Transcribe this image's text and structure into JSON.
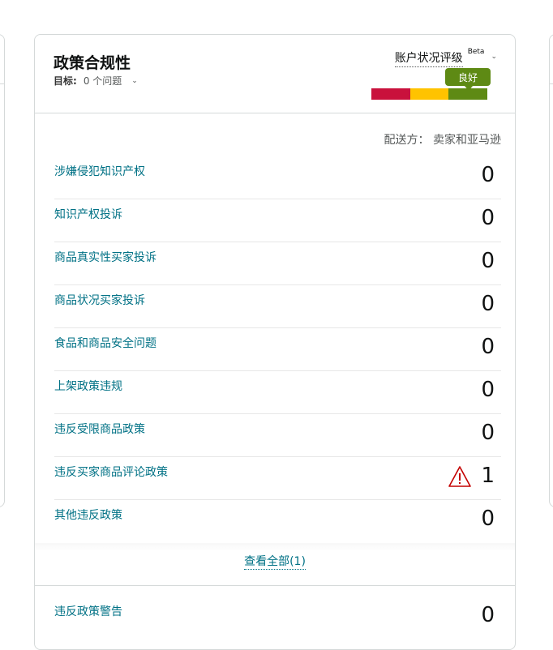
{
  "card": {
    "title": "政策合规性",
    "target_label": "目标:",
    "target_value": "0 个问题",
    "ahr_label": "账户状况评级",
    "ahr_beta": "Beta",
    "ahr_status": "良好",
    "ahr_status_color": "#5e8a14",
    "ahr_colors": [
      "#c9113c",
      "#ffc300",
      "#5e8a14"
    ],
    "ship_by": "配送方：  卖家和亚马逊",
    "rows": [
      {
        "label": "涉嫌侵犯知识产权",
        "value": "0"
      },
      {
        "label": "知识产权投诉",
        "value": "0"
      },
      {
        "label": "商品真实性买家投诉",
        "value": "0"
      },
      {
        "label": "商品状况买家投诉",
        "value": "0"
      },
      {
        "label": "食品和商品安全问题",
        "value": "0"
      },
      {
        "label": "上架政策违规",
        "value": "0"
      },
      {
        "label": "违反受限商品政策",
        "value": "0"
      },
      {
        "label": "违反买家商品评论政策",
        "value": "1",
        "warning": true
      },
      {
        "label": "其他违反政策",
        "value": "0"
      }
    ],
    "view_all": "查看全部(1)",
    "footer_row": {
      "label": "违反政策警告",
      "value": "0"
    }
  }
}
